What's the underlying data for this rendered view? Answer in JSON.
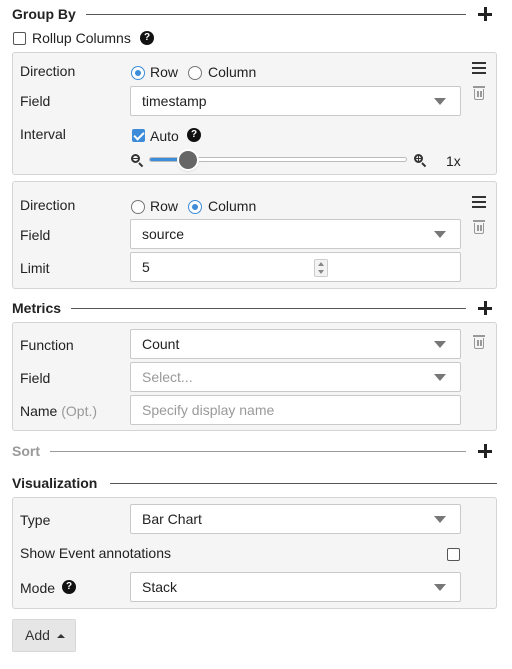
{
  "group_by": {
    "title": "Group By",
    "rollup_label": "Rollup Columns",
    "rollup_checked": false,
    "row1": {
      "direction_label": "Direction",
      "row_option": "Row",
      "column_option": "Column",
      "selected": "Row",
      "field_label": "Field",
      "field_value": "timestamp",
      "interval_label": "Interval",
      "auto_label": "Auto",
      "auto_checked": true,
      "zoom_value": "1x",
      "zoom_level_fraction": 0.15
    },
    "row2": {
      "direction_label": "Direction",
      "row_option": "Row",
      "column_option": "Column",
      "selected": "Column",
      "field_label": "Field",
      "field_value": "source",
      "limit_label": "Limit",
      "limit_value": "5"
    }
  },
  "metrics": {
    "title": "Metrics",
    "function_label": "Function",
    "function_value": "Count",
    "field_label": "Field",
    "field_placeholder": "Select...",
    "name_label": "Name",
    "name_opt": "(Opt.)",
    "name_placeholder": "Specify display name"
  },
  "sort": {
    "title": "Sort"
  },
  "visualization": {
    "title": "Visualization",
    "type_label": "Type",
    "type_value": "Bar Chart",
    "annotations_label": "Show Event annotations",
    "annotations_checked": false,
    "mode_label": "Mode",
    "mode_value": "Stack"
  },
  "add_label": "Add",
  "colors": {
    "accent": "#3d8cd9",
    "panel_bg": "#f5f5f5",
    "muted_text": "#999999"
  },
  "icons": [
    "plus-icon",
    "help-icon",
    "menu-icon",
    "trash-icon",
    "zoom-out-icon",
    "zoom-in-icon",
    "caret-down-icon",
    "caret-up-icon"
  ]
}
